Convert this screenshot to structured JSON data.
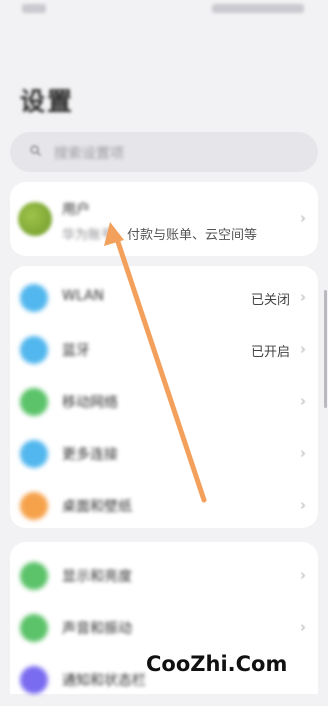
{
  "status_bar": {
    "left_text": "",
    "right_text": ""
  },
  "page": {
    "title": "设置"
  },
  "search": {
    "placeholder": "搜索设置项"
  },
  "account": {
    "name": "用户",
    "subtitle_blurred": "华为账号、",
    "subtitle_visible": "付款与账单、云空间等"
  },
  "group1": {
    "items": [
      {
        "label": "WLAN",
        "value": "已关闭",
        "icon": "wlan-icon",
        "color": "#52b7ee"
      },
      {
        "label": "蓝牙",
        "value": "已开启",
        "icon": "bluetooth-icon",
        "color": "#52b7ee"
      },
      {
        "label": "移动网络",
        "value": "",
        "icon": "mobile-network-icon",
        "color": "#5cc36a"
      },
      {
        "label": "更多连接",
        "value": "",
        "icon": "more-connections-icon",
        "color": "#52b7ee"
      },
      {
        "label": "桌面和壁纸",
        "value": "",
        "icon": "desktop-wallpaper-icon",
        "color": "#f6a24b"
      }
    ]
  },
  "group2": {
    "items": [
      {
        "label": "显示和亮度",
        "value": "",
        "icon": "display-icon",
        "color": "#5cc36a"
      },
      {
        "label": "声音和振动",
        "value": "",
        "icon": "sound-icon",
        "color": "#5cc36a"
      },
      {
        "label": "通知和状态栏",
        "value": "",
        "icon": "notification-icon",
        "color": "#7a6cf0"
      }
    ]
  },
  "colors": {
    "arrow": "#f2a05c"
  },
  "watermark": {
    "text": "CooZhi.Com"
  }
}
